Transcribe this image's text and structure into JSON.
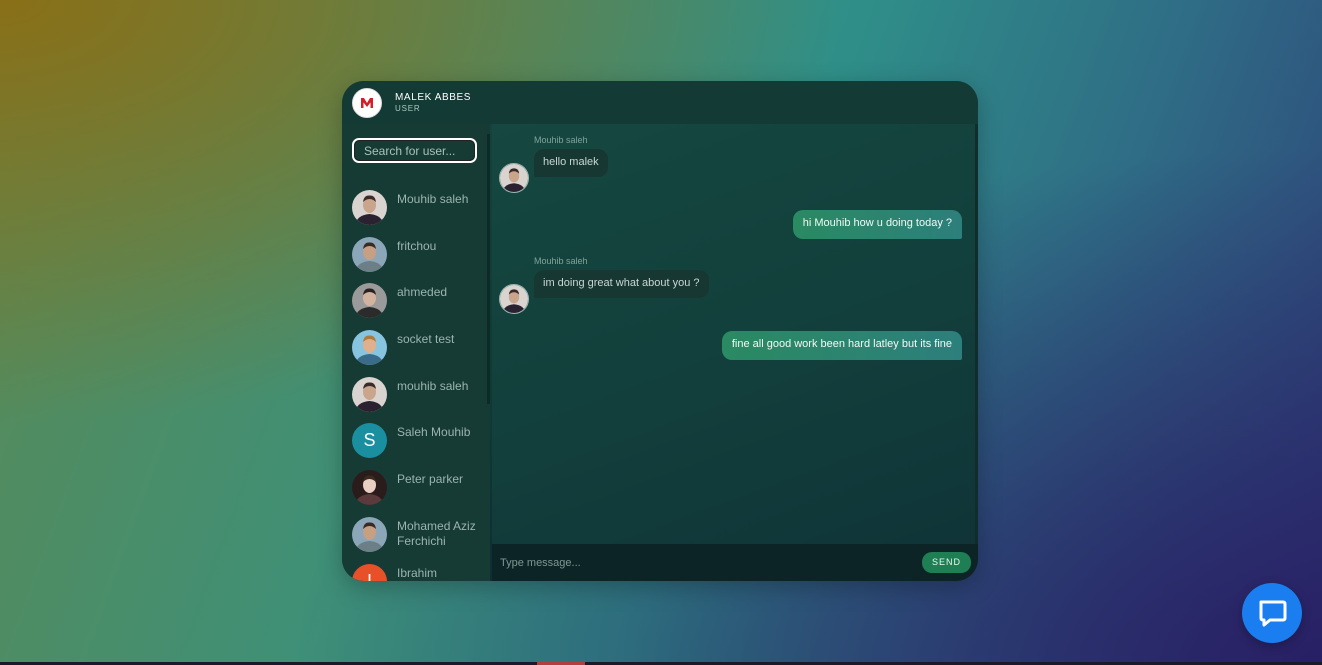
{
  "header": {
    "name": "MALEK ABBES",
    "role": "USER",
    "logo_letter": "M"
  },
  "search": {
    "placeholder": "Search for user..."
  },
  "users": [
    {
      "name": "Mouhib saleh",
      "avatar": "photo-man-suit"
    },
    {
      "name": "fritchou",
      "avatar": "photo-man-patterned-shirt"
    },
    {
      "name": "ahmeded",
      "avatar": "photo-man-beard"
    },
    {
      "name": "socket test",
      "avatar": "photo-woman-sunglasses"
    },
    {
      "name": "mouhib saleh",
      "avatar": "photo-man-suit"
    },
    {
      "name": "Saleh Mouhib",
      "avatar": "letter",
      "letter": "S",
      "color": "#1a8fa0"
    },
    {
      "name": "Peter parker",
      "avatar": "photo-man-face"
    },
    {
      "name": "Mohamed Aziz Ferchichi",
      "avatar": "photo-man-patterned-shirt"
    },
    {
      "name": "Ibrahim",
      "avatar": "letter",
      "letter": "I",
      "color": "#e8502a"
    }
  ],
  "messages": [
    {
      "direction": "in",
      "sender": "Mouhib saleh",
      "text": "hello malek"
    },
    {
      "direction": "out",
      "text": "hi Mouhib how u doing today ?"
    },
    {
      "direction": "in",
      "sender": "Mouhib saleh",
      "text": "im doing great what about you ?"
    },
    {
      "direction": "out",
      "text": "fine all good work been hard latley but its fine"
    }
  ],
  "composer": {
    "placeholder": "Type message...",
    "send_label": "SEND"
  },
  "colors": {
    "accent": "#1e7f55",
    "support": "#1a7ef0"
  }
}
